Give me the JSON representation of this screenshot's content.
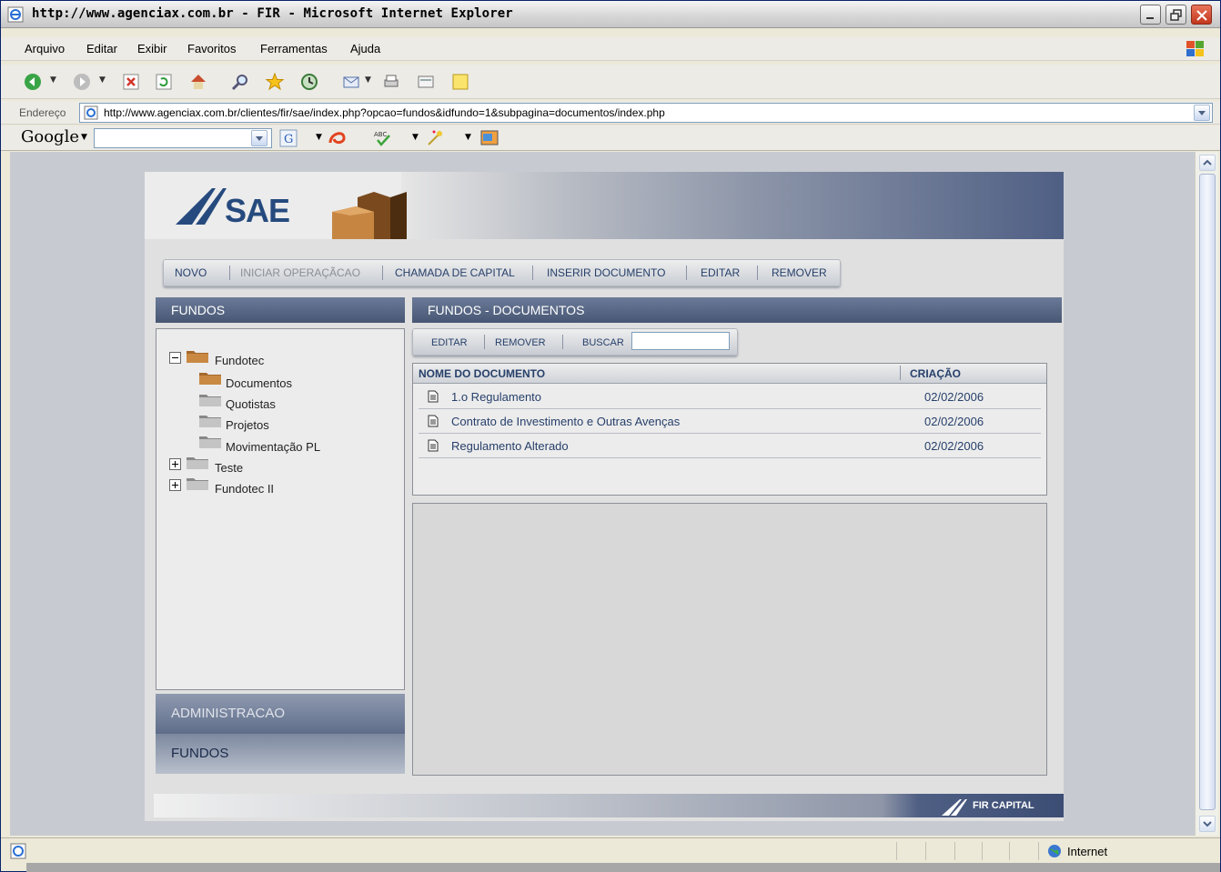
{
  "window": {
    "title": "http://www.agenciax.com.br - FIR - Microsoft Internet Explorer"
  },
  "menu": [
    "Arquivo",
    "Editar",
    "Exibir",
    "Favoritos",
    "Ferramentas",
    "Ajuda"
  ],
  "address": {
    "label": "Endereço",
    "url": "http://www.agenciax.com.br/clientes/fir/sae/index.php?opcao=fundos&idfundo=1&subpagina=documentos/index.php"
  },
  "google": {
    "logo": "Google"
  },
  "site": {
    "logo_text": "SAE",
    "topnav": [
      {
        "label": "NOVO",
        "enabled": true
      },
      {
        "label": "INICIAR OPERAÇÃCAO",
        "enabled": false
      },
      {
        "label": "CHAMADA DE CAPITAL",
        "enabled": true
      },
      {
        "label": "INSERIR DOCUMENTO",
        "enabled": true
      },
      {
        "label": "EDITAR",
        "enabled": true
      },
      {
        "label": "REMOVER",
        "enabled": true
      }
    ],
    "left_panel": {
      "title": "FUNDOS",
      "tree": [
        {
          "label": "Fundotec",
          "expanded": true
        },
        {
          "label": "Documentos"
        },
        {
          "label": "Quotistas"
        },
        {
          "label": "Projetos"
        },
        {
          "label": "Movimentação PL"
        },
        {
          "label": "Teste",
          "expanded": false
        },
        {
          "label": "Fundotec II",
          "expanded": false
        }
      ],
      "admin_label": "ADMINISTRACAO",
      "fundos_label": "FUNDOS"
    },
    "right_panel": {
      "title": "FUNDOS - DOCUMENTOS",
      "tools": {
        "edit": "EDITAR",
        "remove": "REMOVER",
        "search": "BUSCAR",
        "search_value": ""
      },
      "columns": {
        "name": "NOME DO DOCUMENTO",
        "created": "CRIAÇÃO"
      },
      "rows": [
        {
          "name": "1.o Regulamento",
          "created": "02/02/2006"
        },
        {
          "name": "Contrato de Investimento e Outras Avenças",
          "created": "02/02/2006"
        },
        {
          "name": "Regulamento Alterado",
          "created": "02/02/2006"
        }
      ]
    },
    "footer": "FIR CAPITAL"
  },
  "status": {
    "zone": "Internet"
  },
  "colors": {
    "accent": "#465673",
    "link": "#27406b",
    "brand": "#264a7e"
  }
}
